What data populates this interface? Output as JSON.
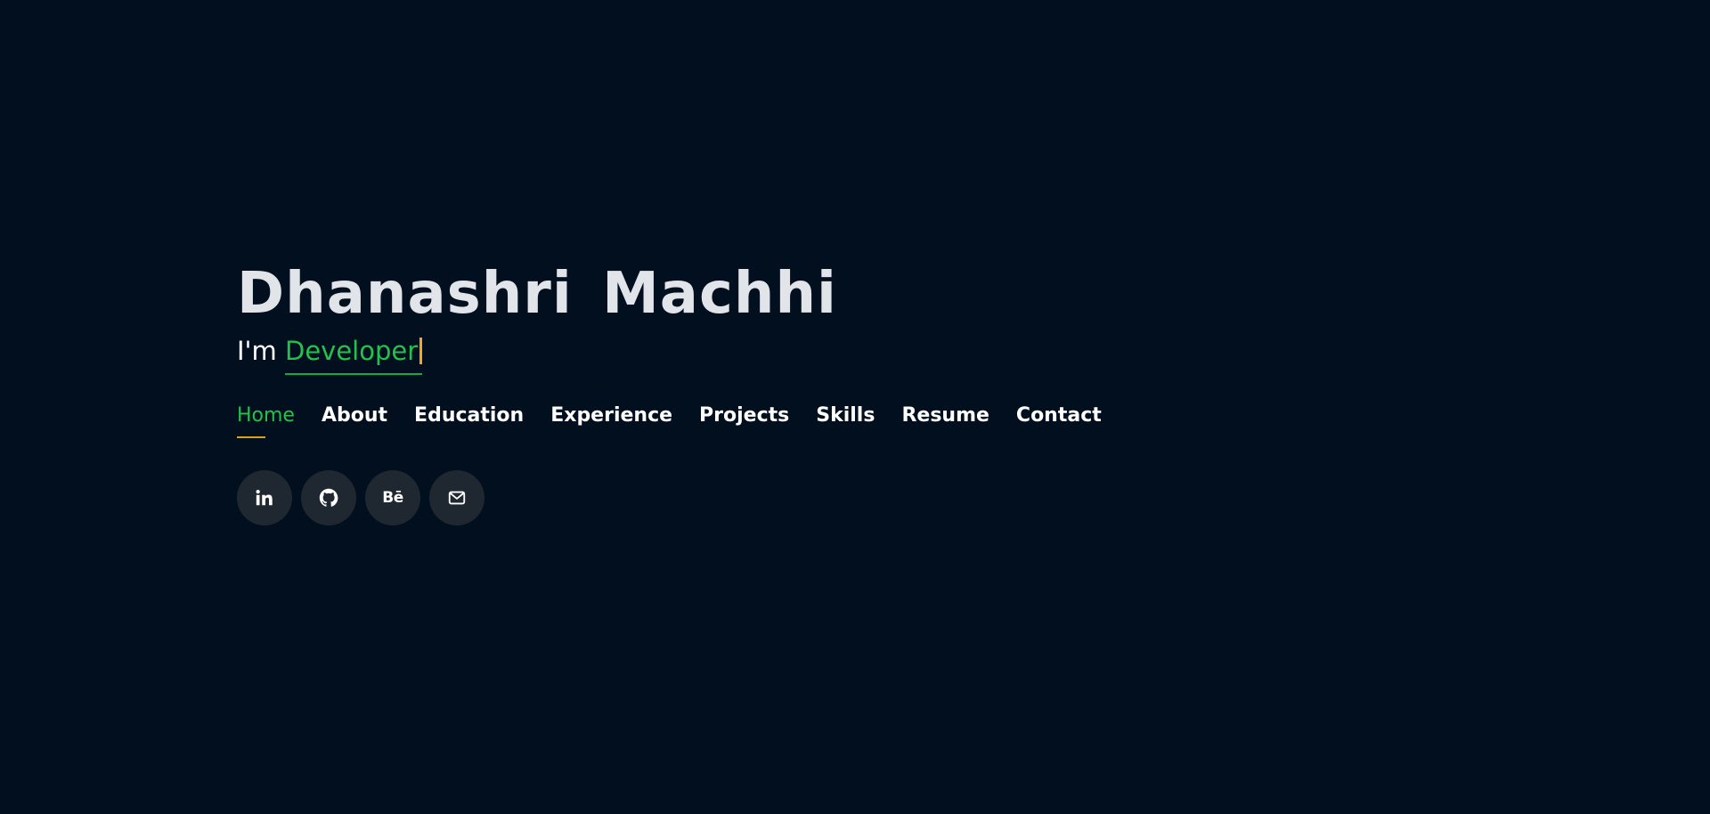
{
  "hero": {
    "name": "Dhanashri Machhi",
    "tagline_prefix": "I'm ",
    "typed_word": "Developer"
  },
  "nav": {
    "items": [
      {
        "label": "Home",
        "active": true
      },
      {
        "label": "About"
      },
      {
        "label": "Education"
      },
      {
        "label": "Experience"
      },
      {
        "label": "Projects"
      },
      {
        "label": "Skills"
      },
      {
        "label": "Resume"
      },
      {
        "label": "Contact"
      }
    ]
  },
  "socials": [
    {
      "icon": "linkedin-icon"
    },
    {
      "icon": "github-icon"
    },
    {
      "icon": "behance-icon",
      "glyph": "Bē"
    },
    {
      "icon": "mail-icon"
    }
  ],
  "colors": {
    "background": "#010f1e",
    "accent_green": "#24c24d",
    "accent_orange": "#f2a91f",
    "social_bg": "#1f2731",
    "name_text": "#e1e5ea"
  }
}
